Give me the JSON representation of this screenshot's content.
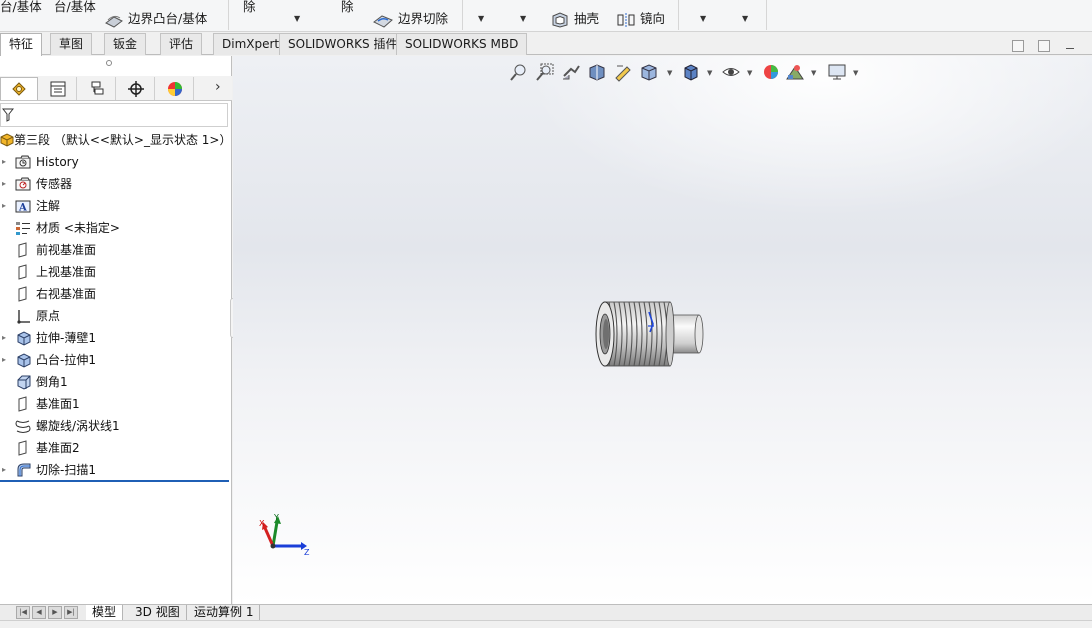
{
  "ribbon": {
    "boss_base_cut": "台/基体",
    "boss_base_cut2": "台/基体",
    "boundary_boss": "边界凸台/基体",
    "remove1": "除",
    "remove2": "除",
    "boundary_cut": "边界切除",
    "shell": "抽壳",
    "mirror": "镜向"
  },
  "tabs": [
    "特征",
    "草图",
    "钣金",
    "评估",
    "DimXpert",
    "SOLIDWORKS 插件",
    "SOLIDWORKS MBD"
  ],
  "tree": {
    "root": "第三段 （默认<<默认>_显示状态 1>）",
    "items": [
      {
        "label": "History",
        "icon": "history-folder-icon"
      },
      {
        "label": "传感器",
        "icon": "sensor-folder-icon"
      },
      {
        "label": "注解",
        "icon": "annotation-folder-icon"
      },
      {
        "label": "材质 <未指定>",
        "icon": "material-icon"
      },
      {
        "label": "前视基准面",
        "icon": "plane-icon"
      },
      {
        "label": "上视基准面",
        "icon": "plane-icon"
      },
      {
        "label": "右视基准面",
        "icon": "plane-icon"
      },
      {
        "label": "原点",
        "icon": "origin-icon"
      },
      {
        "label": "拉伸-薄壁1",
        "icon": "extrude-icon"
      },
      {
        "label": "凸台-拉伸1",
        "icon": "extrude-icon"
      },
      {
        "label": "倒角1",
        "icon": "chamfer-icon"
      },
      {
        "label": "基准面1",
        "icon": "plane-icon"
      },
      {
        "label": "螺旋线/涡状线1",
        "icon": "helix-icon"
      },
      {
        "label": "基准面2",
        "icon": "plane-icon"
      },
      {
        "label": "切除-扫描1",
        "icon": "swept-cut-icon"
      }
    ]
  },
  "triad": {
    "x": "X",
    "y": "Y",
    "z": "Z"
  },
  "bottom_tabs": [
    "模型",
    "3D 视图",
    "运动算例 1"
  ],
  "colors": {
    "accent": "#1f5fb5",
    "selection": "#1f5fb5",
    "part": "#d9d9d9"
  }
}
